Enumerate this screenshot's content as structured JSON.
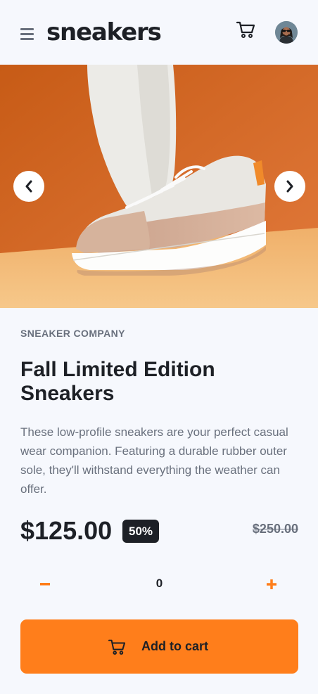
{
  "header": {
    "logo": "sneakers"
  },
  "product": {
    "company": "SNEAKER COMPANY",
    "title": "Fall Limited Edition Sneakers",
    "description": "These low-profile sneakers are your perfect casual wear companion. Featuring a durable rubber outer sole, they'll withstand everything the weather can offer.",
    "price": "$125.00",
    "discount": "50%",
    "original_price": "$250.00"
  },
  "quantity": {
    "value": "0"
  },
  "actions": {
    "add_to_cart_label": "Add to cart"
  },
  "icons": {
    "menu": "menu-icon",
    "cart": "cart-icon",
    "prev": "chevron-left-icon",
    "next": "chevron-right-icon",
    "minus": "minus-icon",
    "plus": "plus-icon"
  },
  "colors": {
    "accent": "#ff7e1b",
    "dark": "#1d2026",
    "muted": "#69707d",
    "background": "#f6f8fd"
  }
}
